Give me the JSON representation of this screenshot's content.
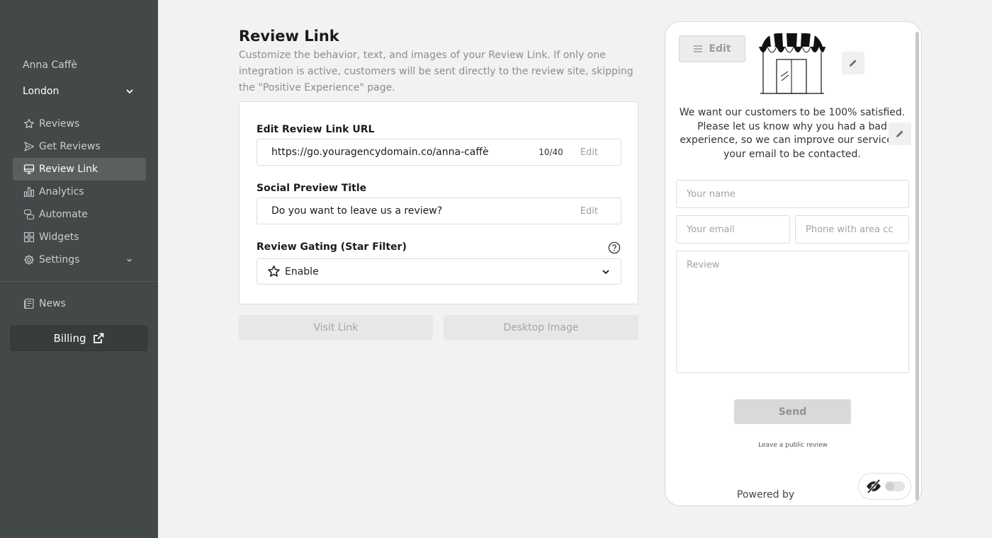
{
  "sidebar": {
    "brand": "Anna Caffè",
    "location": "London",
    "nav": [
      {
        "label": "Reviews",
        "icon": "star-icon"
      },
      {
        "label": "Get Reviews",
        "icon": "send-icon"
      },
      {
        "label": "Review Link",
        "icon": "monitor-icon",
        "active": true
      },
      {
        "label": "Analytics",
        "icon": "bar-chart-icon"
      },
      {
        "label": "Automate",
        "icon": "automate-icon"
      },
      {
        "label": "Widgets",
        "icon": "widgets-icon"
      },
      {
        "label": "Settings",
        "icon": "gear-icon",
        "has_submenu": true
      }
    ],
    "news": "News",
    "billing": "Billing"
  },
  "main": {
    "title": "Review Link",
    "description": "Customize the behavior, text, and images of your Review Link. If only one integration is active, customers will be sent directly to the review site, skipping the \"Positive Experience\" page.",
    "url_label": "Edit Review Link URL",
    "url_value": "https://go.youragencydomain.co/anna-caffè",
    "url_count": "10/40",
    "edit_label": "Edit",
    "social_label": "Social Preview Title",
    "social_value": "Do you want to leave us a review?",
    "gating_label": "Review Gating (Star Filter)",
    "gating_value": "Enable",
    "visit_link": "Visit Link",
    "desktop_image": "Desktop Image"
  },
  "preview": {
    "edit": "Edit",
    "message": "We want our customers to be 100% satisfied. Please let us know why you had a bad experience, so we can improve our service. L your email to be contacted.",
    "name_placeholder": "Your name",
    "email_placeholder": "Your email",
    "phone_placeholder": "Phone with area cc",
    "review_placeholder": "Review",
    "send": "Send",
    "public_review": "Leave a public review",
    "powered_by": "Powered by"
  },
  "colors": {
    "sidebar_bg": "#434849",
    "active_item_bg": "#5a5f60",
    "page_bg": "#f2f2f2"
  }
}
